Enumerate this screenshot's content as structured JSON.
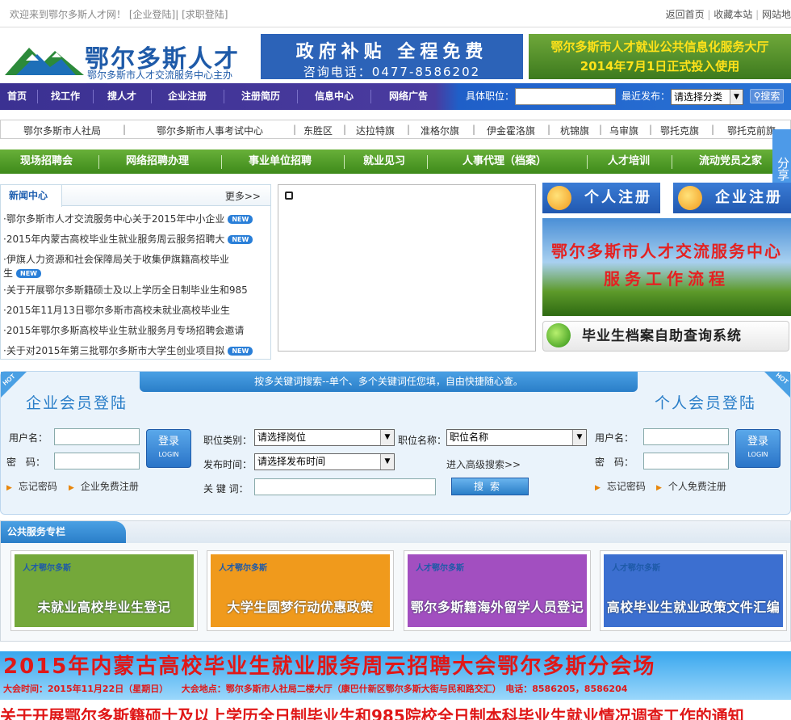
{
  "topbar": {
    "welcome": "欢迎来到鄂尔多斯人才网！",
    "company_login": "[企业登陆]",
    "seeker_login": "[求职登陆]",
    "home": "返回首页",
    "favorite": "收藏本站",
    "sitemap": "网站地"
  },
  "header": {
    "logo_name": "鄂尔多斯人才网",
    "logo_sub": "鄂尔多斯市人才交流服务中心主办",
    "banner1_line1": "政府补贴  全程免费",
    "banner1_line2": "咨询电话：0477-8586202",
    "banner2_line1": "鄂尔多斯市人才就业公共信息化服务大厅",
    "banner2_line2": "2014年7月1日正式投入使用"
  },
  "nav": {
    "items": [
      "首页",
      "找工作",
      "搜人才",
      "企业注册",
      "注册简历",
      "信息中心",
      "网络广告"
    ],
    "position_label": "具体职位：",
    "latest_label": "最近发布：",
    "category_select": "请选择分类",
    "search_button": "搜索"
  },
  "links": [
    "鄂尔多斯市人社局",
    "鄂尔多斯市人事考试中心",
    "东胜区",
    "达拉特旗",
    "准格尔旗",
    "伊金霍洛旗",
    "杭锦旗",
    "乌审旗",
    "鄂托克旗",
    "鄂托克前旗"
  ],
  "green_nav": [
    "现场招聘会",
    "网络招聘办理",
    "事业单位招聘",
    "就业见习",
    "人事代理（档案）",
    "人才培训",
    "流动党员之家"
  ],
  "share": "分享",
  "news": {
    "title": "新闻中心",
    "more": "更多>>",
    "badge": "NEW",
    "items": [
      "·鄂尔多斯市人才交流服务中心关于2015年中小企业",
      "·2015年内蒙古高校毕业生就业服务周云服务招聘大",
      "·伊旗人力资源和社会保障局关于收集伊旗籍高校毕业生",
      "·关于开展鄂尔多斯籍硕士及以上学历全日制毕业生和985",
      "·2015年11月13日鄂尔多斯市高校未就业高校毕业生",
      "·2015年鄂尔多斯高校毕业生就业服务月专场招聘会邀请",
      "·关于对2015年第三批鄂尔多斯市大学生创业项目拟"
    ]
  },
  "right": {
    "personal_register": "个人注册",
    "company_register": "企业注册",
    "flow_line1": "鄂尔多斯市人才交流服务中心",
    "flow_line2": "服务工作流程",
    "archive_query": "毕业生档案自助查询系统"
  },
  "login": {
    "tip": "按多关键词搜索--单个、多个关键词任您填，自由快捷随心查。",
    "hot": "HOT",
    "company_title": "企业会员登陆",
    "personal_title": "个人会员登陆",
    "username": "用户名：",
    "password": "密　码：",
    "login_btn": "登录",
    "login_btn_en": "LOGIN",
    "forgot": "忘记密码",
    "company_free_register": "企业免费注册",
    "personal_free_register": "个人免费注册",
    "job_category_label": "职位类别：",
    "job_category_value": "请选择岗位",
    "job_name_label": "职位名称：",
    "job_name_value": "职位名称",
    "publish_time_label": "发布时间：",
    "publish_time_value": "请选择发布时间",
    "advanced": "进入高级搜索>>",
    "keyword_label": "关 键 词：",
    "search_btn": "搜索"
  },
  "services": {
    "title": "公共服务专栏",
    "logo_text": "人才鄂尔多斯",
    "cards": [
      {
        "label": "未就业高校毕业生登记",
        "color": "#74a83a"
      },
      {
        "label": "大学生圆梦行动优惠政策",
        "color": "#f09a1c"
      },
      {
        "label": "鄂尔多斯籍海外留学人员登记",
        "color": "#a24fc0"
      },
      {
        "label": "高校毕业生就业政策文件汇编",
        "color": "#3c6fd0"
      }
    ]
  },
  "bottom_banner": {
    "title": "2015年内蒙古高校毕业生就业服务周云招聘大会鄂尔多斯分会场",
    "info": "大会时间：2015年11月22日（星期日）　　大会地点：鄂尔多斯市人社局二楼大厅（康巴什新区鄂尔多斯大街与民和路交汇）　电话：8586205，8586204"
  },
  "ticker": "关于开展鄂尔多斯籍硕士及以上学历全日制毕业生和985院校全日制本科毕业生就业情况调查工作的通知"
}
